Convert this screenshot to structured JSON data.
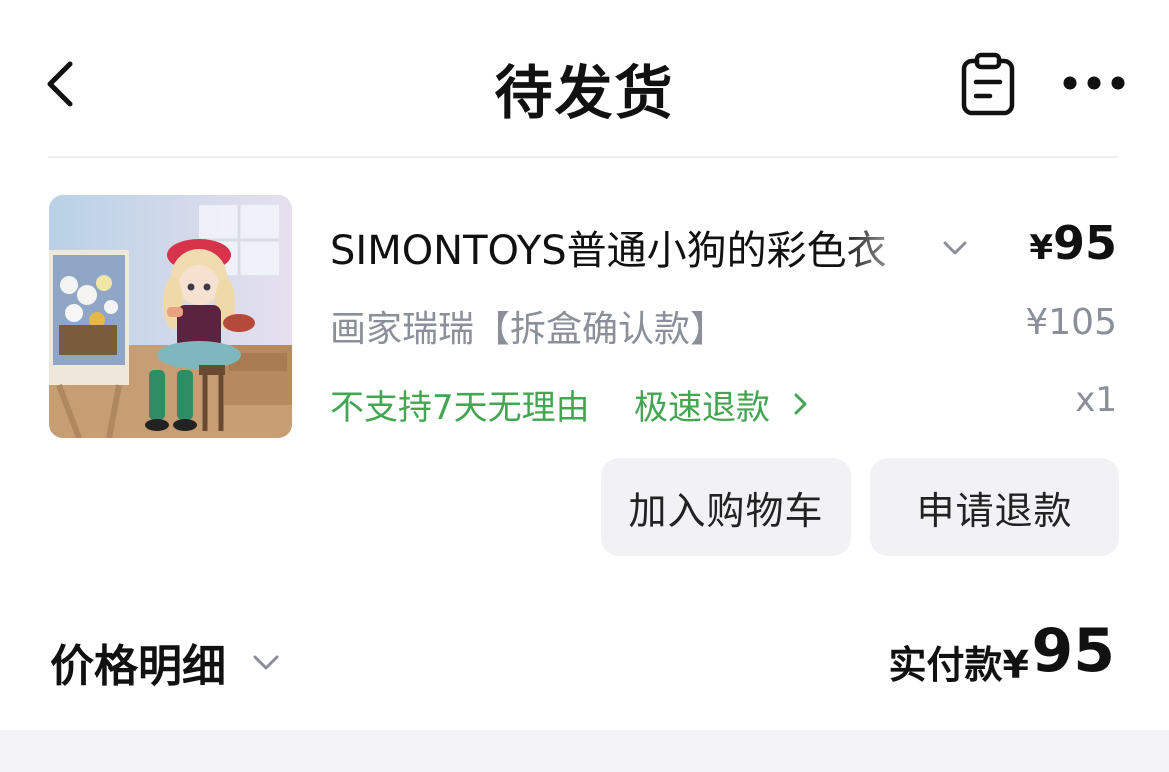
{
  "header": {
    "title": "待发货",
    "back_icon": "chevron-left-icon",
    "clipboard_icon": "clipboard-icon",
    "more_icon": "more-horizontal-icon"
  },
  "product": {
    "name": "SIMONTOYS普通小狗的彩色衣",
    "variant": "画家瑞瑞【拆盒确认款】",
    "price_symbol": "¥",
    "price_now": "95",
    "price_original": "¥105",
    "return_policy": "不支持7天无理由",
    "fast_refund": "极速退款",
    "quantity": "x1"
  },
  "actions": {
    "add_to_cart": "加入购物车",
    "request_refund": "申请退款"
  },
  "summary": {
    "price_detail_label": "价格明细",
    "total_label": "实付款",
    "total_symbol": "¥",
    "total_amount": "95"
  },
  "colors": {
    "accent_green": "#44a653",
    "muted_gray": "#8a8f99",
    "button_bg": "#f2f2f4"
  }
}
